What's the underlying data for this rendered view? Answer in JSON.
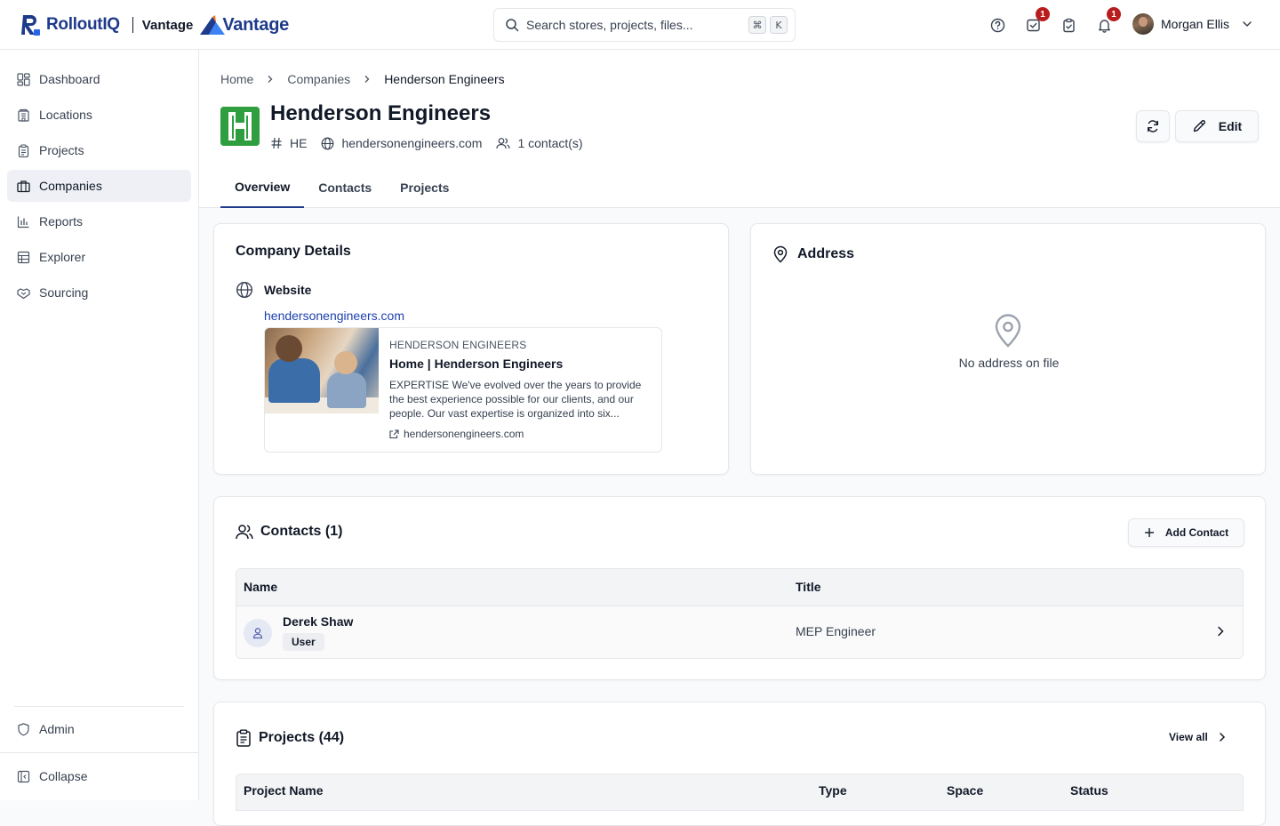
{
  "brand": {
    "name": "RolloutIQ",
    "product": "Vantage",
    "product_logo_word": "Vantage",
    "color": "#1e3a8a"
  },
  "search": {
    "placeholder": "Search stores, projects, files...",
    "shortcut_mod": "⌘",
    "shortcut_key": "K"
  },
  "topbar": {
    "icons": [
      {
        "name": "help-icon",
        "badge": ""
      },
      {
        "name": "tasks-icon",
        "badge": "1"
      },
      {
        "name": "clipboard-icon",
        "badge": ""
      },
      {
        "name": "bell-icon",
        "badge": "1"
      }
    ],
    "user_name": "Morgan Ellis"
  },
  "sidebar": {
    "items": [
      {
        "label": "Dashboard",
        "icon": "dashboard-icon",
        "active": false
      },
      {
        "label": "Locations",
        "icon": "building-icon",
        "active": false
      },
      {
        "label": "Projects",
        "icon": "clipboard-icon",
        "active": false
      },
      {
        "label": "Companies",
        "icon": "briefcase-icon",
        "active": true
      },
      {
        "label": "Reports",
        "icon": "bar-chart-icon",
        "active": false
      },
      {
        "label": "Explorer",
        "icon": "table-icon",
        "active": false
      },
      {
        "label": "Sourcing",
        "icon": "handshake-icon",
        "active": false
      }
    ],
    "admin_label": "Admin",
    "collapse_label": "Collapse"
  },
  "breadcrumb": [
    "Home",
    "Companies",
    "Henderson Engineers"
  ],
  "company": {
    "name": "Henderson Engineers",
    "code": "HE",
    "website": "hendersonengineers.com",
    "contacts_count": "1 contact(s)",
    "logo_color": "#2e9e3e"
  },
  "actions": {
    "edit_label": "Edit"
  },
  "tabs": [
    {
      "label": "Overview",
      "active": true
    },
    {
      "label": "Contacts",
      "active": false
    },
    {
      "label": "Projects",
      "active": false
    }
  ],
  "details": {
    "title": "Company Details",
    "website_label": "Website",
    "website_url": "hendersonengineers.com",
    "preview": {
      "site_name": "HENDERSON ENGINEERS",
      "title": "Home | Henderson Engineers",
      "description": "EXPERTISE We've evolved over the years to provide the best experience possible for our clients, and our people. Our vast expertise is organized into six...",
      "url": "hendersonengineers.com"
    }
  },
  "address": {
    "title": "Address",
    "empty_text": "No address on file"
  },
  "contacts": {
    "title": "Contacts (1)",
    "add_label": "Add Contact",
    "columns": [
      "Name",
      "Title"
    ],
    "rows": [
      {
        "name": "Derek Shaw",
        "role": "User",
        "title": "MEP Engineer"
      }
    ]
  },
  "projects": {
    "title": "Projects (44)",
    "view_all_label": "View all",
    "columns": [
      "Project Name",
      "Type",
      "Space",
      "Status"
    ]
  }
}
